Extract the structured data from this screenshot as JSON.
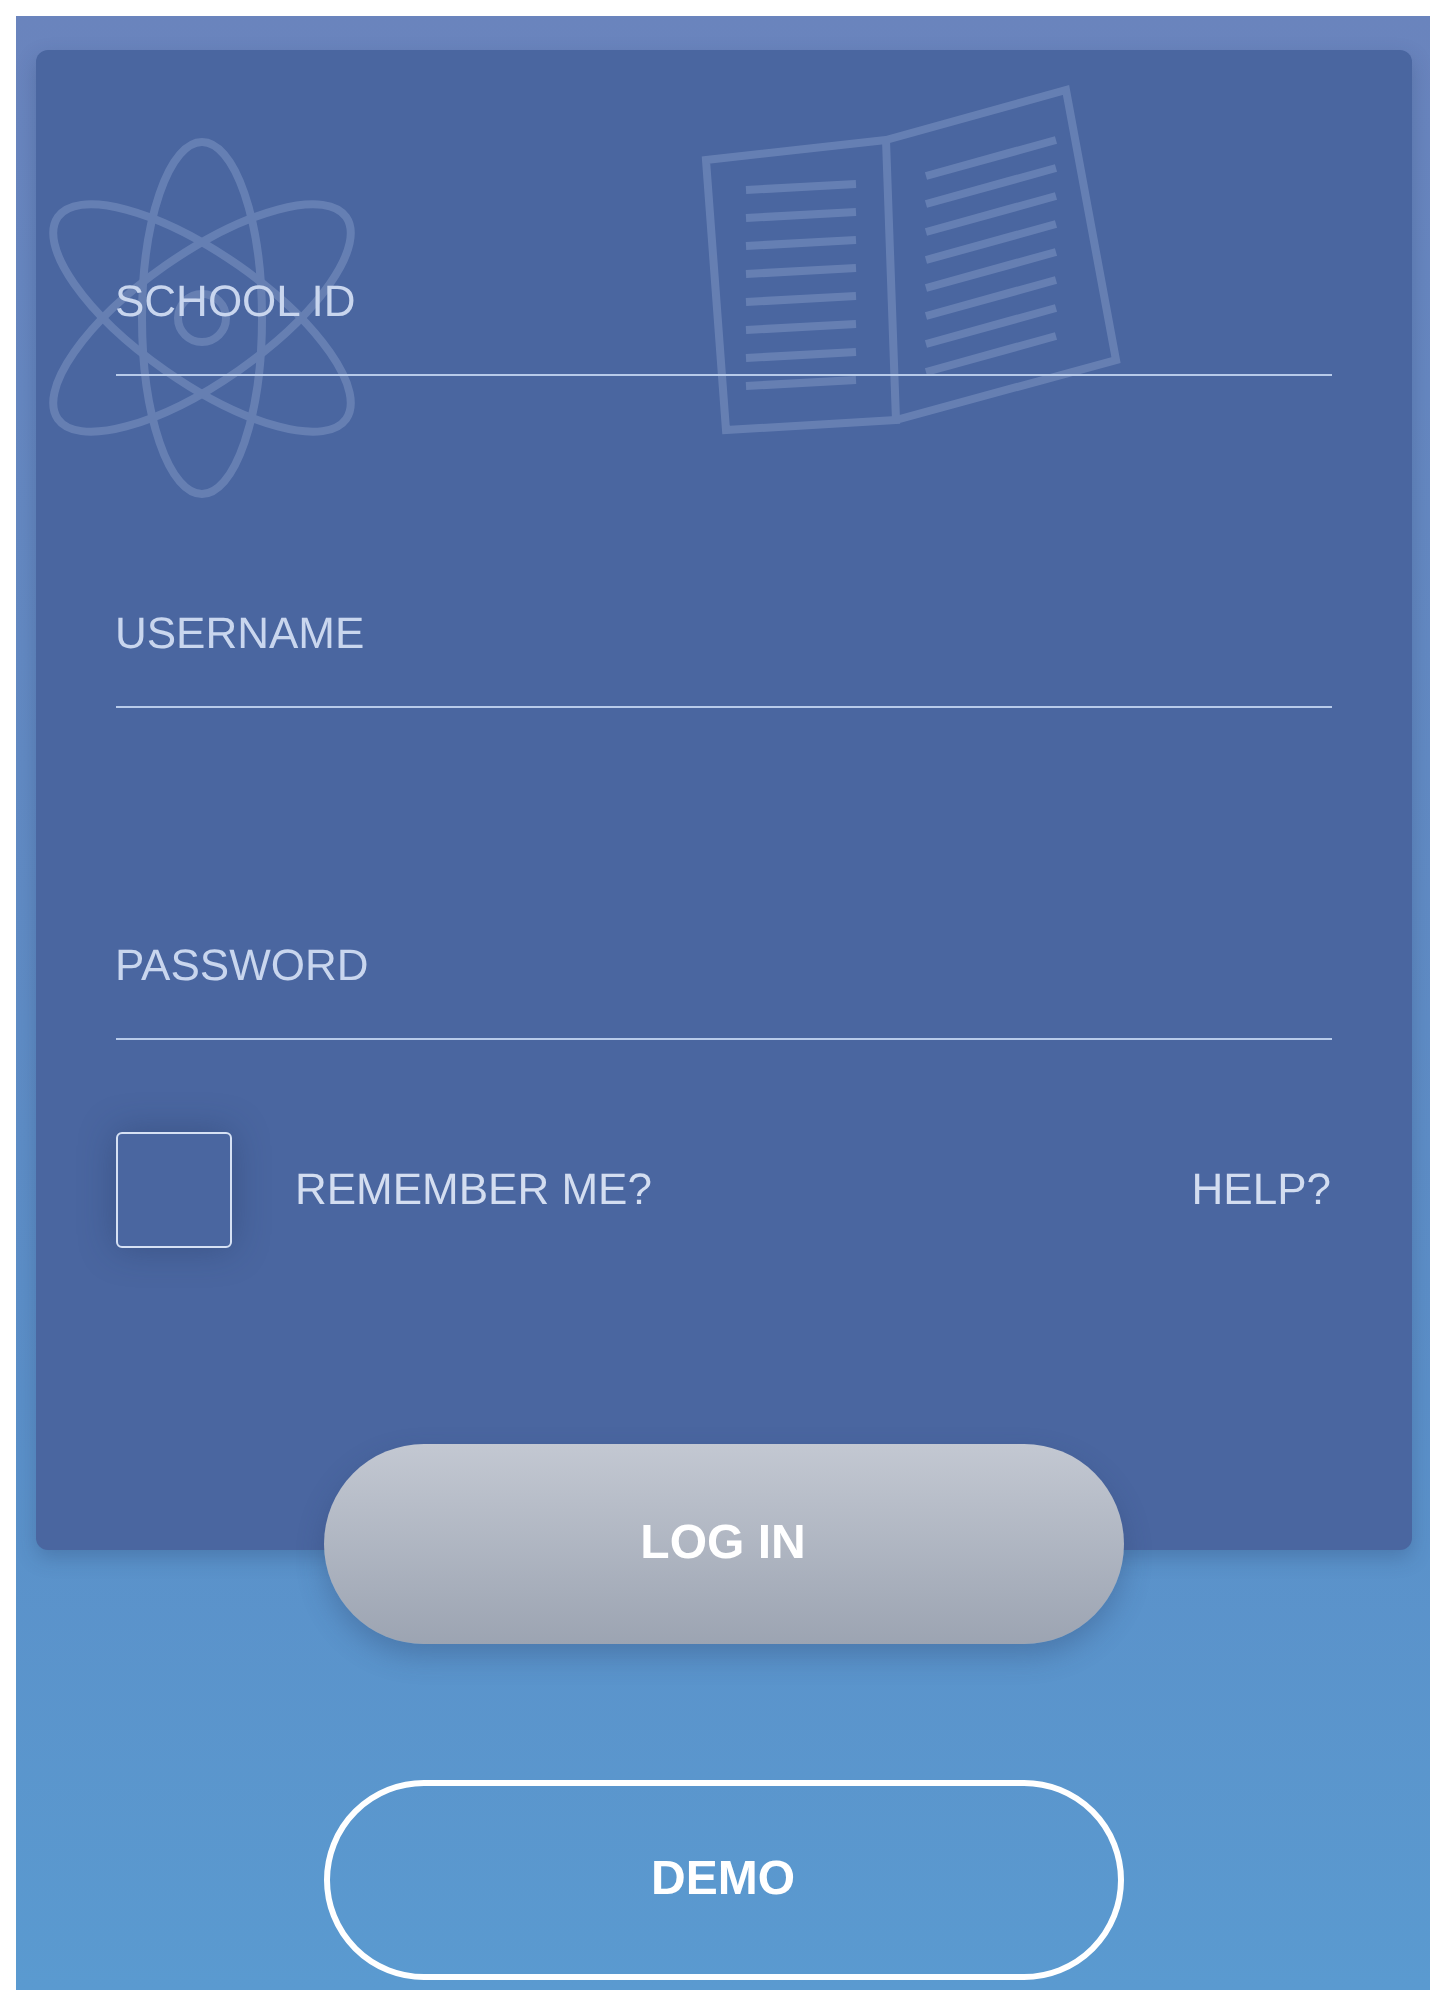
{
  "fields": [
    {
      "placeholder": "SCHOOL ID"
    },
    {
      "placeholder": "USERNAME"
    },
    {
      "placeholder": "PASSWORD"
    }
  ],
  "remember": {
    "label": "REMEMBER ME?",
    "checked": false
  },
  "help": "HELP?",
  "buttons": [
    {
      "label": "LOG IN",
      "kind": "primary"
    },
    {
      "label": "DEMO",
      "kind": "outline"
    }
  ]
}
